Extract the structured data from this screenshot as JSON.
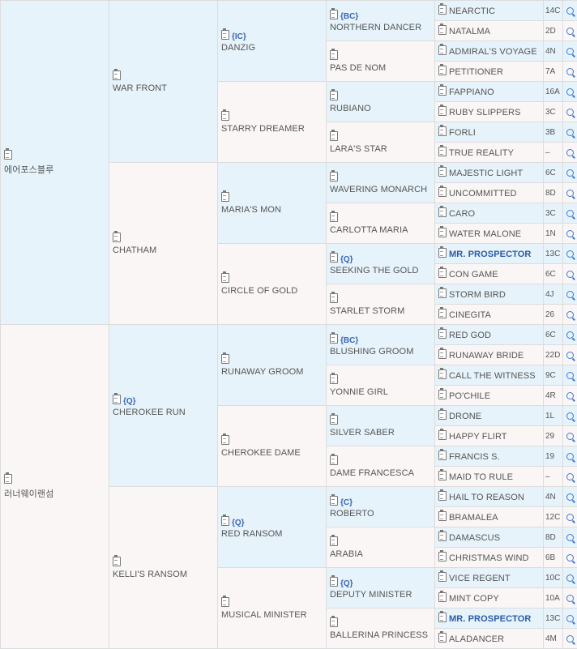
{
  "pedigree": {
    "gen1": [
      {
        "name": "에어포스블루"
      },
      {
        "name": "러너웨이랜섬"
      }
    ],
    "gen2": [
      {
        "name": "WAR FRONT"
      },
      {
        "name": "CHATHAM"
      },
      {
        "name": "CHEROKEE RUN",
        "dosage": "{Q}"
      },
      {
        "name": "KELLI'S RANSOM"
      }
    ],
    "gen3": [
      {
        "name": "DANZIG",
        "dosage": "{IC}"
      },
      {
        "name": "STARRY DREAMER"
      },
      {
        "name": "MARIA'S MON"
      },
      {
        "name": "CIRCLE OF GOLD"
      },
      {
        "name": "RUNAWAY GROOM"
      },
      {
        "name": "CHEROKEE DAME"
      },
      {
        "name": "RED RANSOM",
        "dosage": "{Q}"
      },
      {
        "name": "MUSICAL MINISTER"
      }
    ],
    "gen4": [
      {
        "name": "NORTHERN DANCER",
        "dosage": "{BC}"
      },
      {
        "name": "PAS DE NOM"
      },
      {
        "name": "RUBIANO"
      },
      {
        "name": "LARA'S STAR"
      },
      {
        "name": "WAVERING MONARCH"
      },
      {
        "name": "CARLOTTA MARIA"
      },
      {
        "name": "SEEKING THE GOLD",
        "dosage": "{Q}"
      },
      {
        "name": "STARLET STORM"
      },
      {
        "name": "BLUSHING GROOM",
        "dosage": "{BC}"
      },
      {
        "name": "YONNIE GIRL"
      },
      {
        "name": "SILVER SABER"
      },
      {
        "name": "DAME FRANCESCA"
      },
      {
        "name": "ROBERTO",
        "dosage": "{C}"
      },
      {
        "name": "ARABIA"
      },
      {
        "name": "DEPUTY MINISTER",
        "dosage": "{Q}"
      },
      {
        "name": "BALLERINA PRINCESS"
      }
    ],
    "gen5": [
      {
        "name": "NEARCTIC",
        "code": "14C",
        "bold": false
      },
      {
        "name": "NATALMA",
        "code": "2D",
        "bold": false
      },
      {
        "name": "ADMIRAL'S VOYAGE",
        "code": "4N",
        "bold": false
      },
      {
        "name": "PETITIONER",
        "code": "7A",
        "bold": false
      },
      {
        "name": "FAPPIANO",
        "code": "16A",
        "bold": false
      },
      {
        "name": "RUBY SLIPPERS",
        "code": "3C",
        "bold": false
      },
      {
        "name": "FORLI",
        "code": "3B",
        "bold": false
      },
      {
        "name": "TRUE REALITY",
        "code": "–",
        "bold": false
      },
      {
        "name": "MAJESTIC LIGHT",
        "code": "6C",
        "bold": false
      },
      {
        "name": "UNCOMMITTED",
        "code": "8D",
        "bold": false
      },
      {
        "name": "CARO",
        "code": "3C",
        "bold": false
      },
      {
        "name": "WATER MALONE",
        "code": "1N",
        "bold": false
      },
      {
        "name": "MR. PROSPECTOR",
        "code": "13C",
        "bold": true
      },
      {
        "name": "CON GAME",
        "code": "6C",
        "bold": false
      },
      {
        "name": "STORM BIRD",
        "code": "4J",
        "bold": false
      },
      {
        "name": "CINEGITA",
        "code": "26",
        "bold": false
      },
      {
        "name": "RED GOD",
        "code": "6C",
        "bold": false
      },
      {
        "name": "RUNAWAY BRIDE",
        "code": "22D",
        "bold": false
      },
      {
        "name": "CALL THE WITNESS",
        "code": "9C",
        "bold": false
      },
      {
        "name": "PO'CHILE",
        "code": "4R",
        "bold": false
      },
      {
        "name": "DRONE",
        "code": "1L",
        "bold": false
      },
      {
        "name": "HAPPY FLIRT",
        "code": "29",
        "bold": false
      },
      {
        "name": "FRANCIS S.",
        "code": "19",
        "bold": false
      },
      {
        "name": "MAID TO RULE",
        "code": "–",
        "bold": false
      },
      {
        "name": "HAIL TO REASON",
        "code": "4N",
        "bold": false
      },
      {
        "name": "BRAMALEA",
        "code": "12C",
        "bold": false
      },
      {
        "name": "DAMASCUS",
        "code": "8D",
        "bold": false
      },
      {
        "name": "CHRISTMAS WIND",
        "code": "6B",
        "bold": false
      },
      {
        "name": "VICE REGENT",
        "code": "10C",
        "bold": false
      },
      {
        "name": "MINT COPY",
        "code": "10A",
        "bold": false
      },
      {
        "name": "MR. PROSPECTOR",
        "code": "13C",
        "bold": true
      },
      {
        "name": "ALADANCER",
        "code": "4M",
        "bold": false
      }
    ]
  },
  "icons": {
    "detail": "clipboard-icon",
    "search": "magnifier-icon"
  },
  "colors": {
    "sire_bg": "#e6f3fa",
    "dam_bg": "#fbf6f6",
    "highlight": "#2b5aa8"
  }
}
